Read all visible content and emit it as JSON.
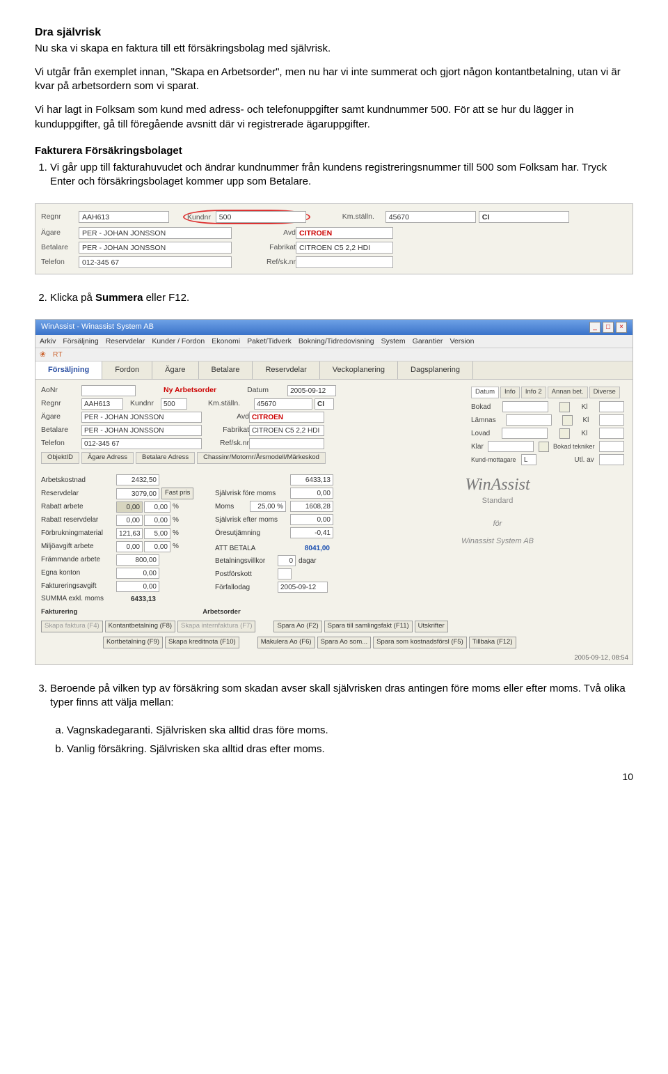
{
  "section_title": "Dra självrisk",
  "intro1": "Nu ska vi skapa en faktura till ett försäkringsbolag med självrisk.",
  "intro2": "Vi utgår från exemplet innan, \"Skapa en Arbetsorder\", men nu har vi inte summerat och gjort någon kontantbetalning, utan vi är kvar på arbetsordern som vi sparat.",
  "intro3": "Vi har lagt in Folksam som kund med adress- och telefonuppgifter samt kundnummer 500. För att se hur du lägger in kunduppgifter, gå till föregående avsnitt där vi registrerade ägaruppgifter.",
  "sub_title": "Fakturera Försäkringsbolaget",
  "step1_pre": "Vi går upp till fakturahuvudet och ändrar kundnummer från kundens registreringsnummer till 500 som Folksam har. Tryck Enter och försäkringsbolaget kommer upp som Betalare.",
  "fig1": {
    "regnr_label": "Regnr",
    "regnr": "AAH613",
    "kundnr_label": "Kundnr",
    "kundnr": "500",
    "kmstalln_label": "Km.ställn.",
    "kmstalln": "45670",
    "ci": "CI",
    "agare_label": "Ägare",
    "agare": "PER - JOHAN JONSSON",
    "avd_label": "Avd",
    "avd": "CITROEN",
    "betalare_label": "Betalare",
    "betalare": "PER - JOHAN JONSSON",
    "fabrikat_label": "Fabrikat",
    "fabrikat": "CITROEN C5 2,2 HDI",
    "telefon_label": "Telefon",
    "telefon": "012-345 67",
    "ref_label": "Ref/sk.nr"
  },
  "step2_pre": "Klicka på ",
  "step2_bold": "Summera",
  "step2_post": " eller F12.",
  "win": {
    "title": "WinAssist - Winassist System AB",
    "menu": [
      "Arkiv",
      "Försäljning",
      "Reservdelar",
      "Kunder / Fordon",
      "Ekonomi",
      "Paket/Tidverk",
      "Bokning/Tidredovisning",
      "System",
      "Garantier",
      "Version"
    ],
    "toolbar": "RT",
    "tabs": [
      "Försäljning",
      "Fordon",
      "Ägare",
      "Betalare",
      "Reservdelar",
      "Veckoplanering",
      "Dagsplanering"
    ],
    "aonr_label": "AoNr",
    "ny_arbetsorder": "Ny Arbetsorder",
    "datum_label": "Datum",
    "datum": "2005-09-12",
    "info_tabs": [
      "Datum",
      "Info",
      "Info 2",
      "Annan bet.",
      "Diverse"
    ],
    "regnr": "AAH613",
    "kundnr": "500",
    "kmstalln": "45670",
    "ci": "CI",
    "agare": "PER - JOHAN JONSSON",
    "avd": "CITROEN",
    "betalare": "PER - JOHAN JONSSON",
    "fabrikat": "CITROEN C5 2,2 HDI",
    "telefon": "012-345 67",
    "right": {
      "bokad": "Bokad",
      "lamnas": "Lämnas",
      "lovad": "Lovad",
      "klar": "Klar",
      "kl": "Kl",
      "bokadtek": "Bokad tekniker",
      "kund": "Kund-mottagare",
      "l": "L",
      "utl": "Utl. av"
    },
    "linkrow": [
      "ObjektID",
      "Ägare Adress",
      "Betalare Adress",
      "Chassinr/Motornr/Årsmodell/Märkeskod"
    ],
    "costs": {
      "arbetskostnad": [
        "Arbetskostnad",
        "2432,50"
      ],
      "reservdelar": [
        "Reservdelar",
        "3079,00"
      ],
      "fastpris": "Fast pris",
      "rabatt_arbete": [
        "Rabatt arbete",
        "0,00",
        "0,00",
        "%"
      ],
      "rabatt_reservdelar": [
        "Rabatt reservdelar",
        "0,00",
        "0,00",
        "%"
      ],
      "forbrukning": [
        "Förbrukningmaterial",
        "121,63",
        "5,00",
        "%"
      ],
      "miljo": [
        "Miljöavgift arbete",
        "0,00",
        "0,00",
        "%"
      ],
      "frammande": [
        "Främmande arbete",
        "800,00"
      ],
      "egna": [
        "Egna konton",
        "0,00"
      ],
      "faktavg": [
        "Faktureringsavgift",
        "0,00"
      ],
      "summa": [
        "SUMMA exkl. moms",
        "6433,13"
      ]
    },
    "mid": {
      "sum": "6433,13",
      "sjalvfore": [
        "Självrisk före moms",
        "0,00"
      ],
      "moms": [
        "Moms",
        "25,00 %",
        "1608,28"
      ],
      "sjalvefter": [
        "Självrisk efter moms",
        "0,00"
      ],
      "ores": [
        "Öresutjämning",
        "-0,41"
      ],
      "att": [
        "ATT BETALA",
        "8041,00"
      ],
      "betvillkor": [
        "Betalningsvillkor",
        "0",
        "dagar"
      ],
      "postforskott": [
        "Postförskott",
        ""
      ],
      "forfallodag": [
        "Förfallodag",
        "2005-09-12"
      ]
    },
    "logo": "WinAssist",
    "logo2": "Standard",
    "logo_for": "för",
    "logo_co": "Winassist System AB",
    "foot1_label": "Fakturering",
    "foot2_label": "Arbetsorder",
    "foot": [
      "Skapa faktura (F4)",
      "Kontantbetalning (F8)",
      "Skapa internfaktura (F7)",
      "Spara Ao (F2)",
      "Spara till samlingsfakt (F11)",
      "Utskrifter",
      "Kortbetalning (F9)",
      "Skapa kreditnota (F10)",
      "Makulera Ao (F6)",
      "Spara Ao som...",
      "Spara som kostnadsförsl (F5)",
      "Tillbaka (F12)"
    ],
    "clock": "2005-09-12, 08:54"
  },
  "step3": "Beroende på vilken typ av försäkring som skadan avser skall självrisken dras antingen före moms eller efter moms. Två olika typer finns att välja mellan:",
  "sub_a": "Vagnskadegaranti. Självrisken ska alltid dras före moms.",
  "sub_b": "Vanlig försäkring. Självrisken ska alltid dras efter moms.",
  "page": "10"
}
